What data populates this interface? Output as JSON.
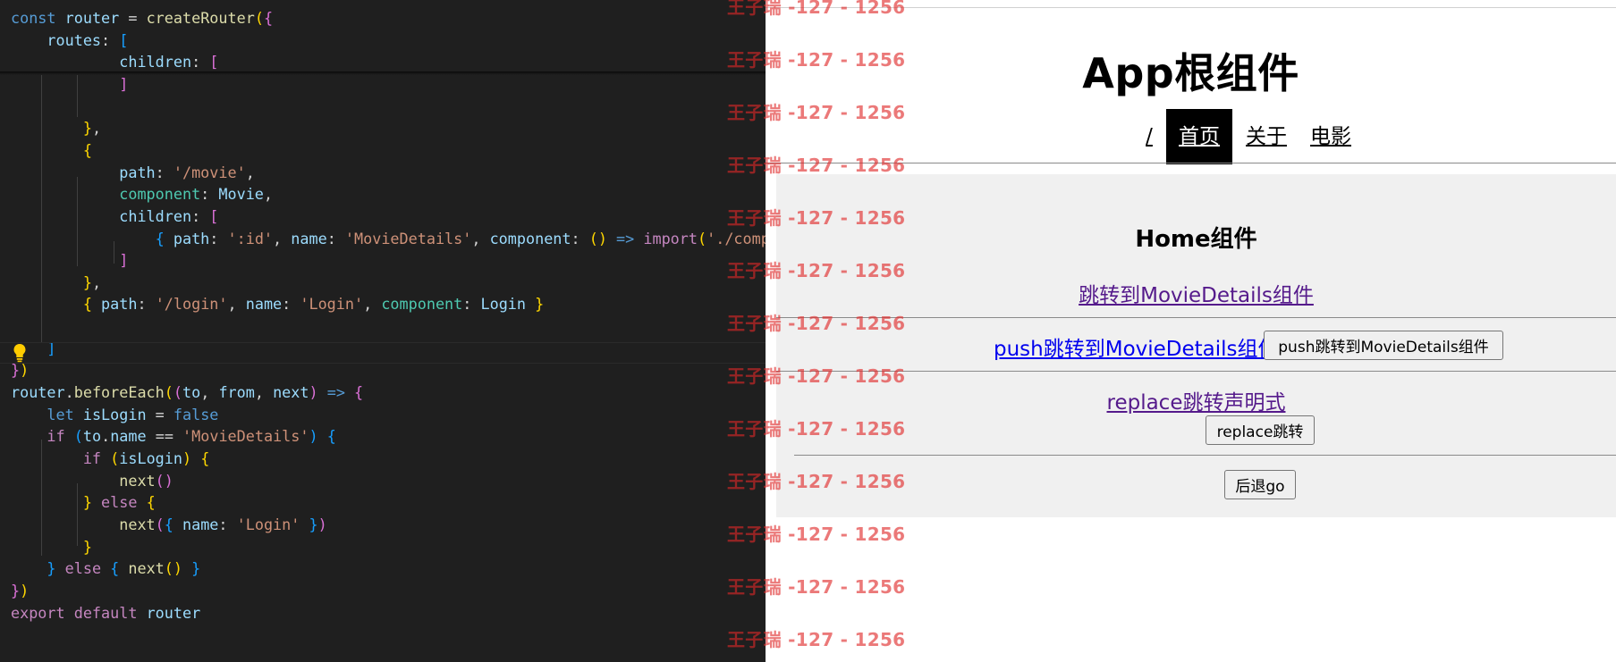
{
  "editor": {
    "lines": [
      [
        [
          "const",
          "kw"
        ],
        [
          " router ",
          "var"
        ],
        [
          "= ",
          "op"
        ],
        [
          "createRouter",
          "fn"
        ],
        [
          "(",
          "b1"
        ],
        [
          "{",
          "b2"
        ]
      ],
      [
        [
          "    routes",
          "var"
        ],
        [
          ": ",
          "op"
        ],
        [
          "[",
          "b3"
        ]
      ],
      [
        [
          "            children",
          "var"
        ],
        [
          ": ",
          "op"
        ],
        [
          "[",
          "b2"
        ]
      ],
      [
        [
          "            ",
          "op"
        ],
        [
          "]",
          "b2"
        ]
      ],
      [
        [
          "",
          ""
        ]
      ],
      [
        [
          "        ",
          "op"
        ],
        [
          "}",
          "b1"
        ],
        [
          ",",
          "op"
        ]
      ],
      [
        [
          "        ",
          "op"
        ],
        [
          "{",
          "b1"
        ]
      ],
      [
        [
          "            path",
          "var"
        ],
        [
          ": ",
          "op"
        ],
        [
          "'/movie'",
          "str"
        ],
        [
          ",",
          "op"
        ]
      ],
      [
        [
          "            component",
          "cls"
        ],
        [
          ": ",
          "op"
        ],
        [
          "Movie",
          "var"
        ],
        [
          ",",
          "op"
        ]
      ],
      [
        [
          "            children",
          "var"
        ],
        [
          ": ",
          "op"
        ],
        [
          "[",
          "b2"
        ]
      ],
      [
        [
          "                ",
          "op"
        ],
        [
          "{",
          "b3"
        ],
        [
          " path",
          "var"
        ],
        [
          ": ",
          "op"
        ],
        [
          "':id'",
          "str"
        ],
        [
          ", ",
          "op"
        ],
        [
          "name",
          "var"
        ],
        [
          ": ",
          "op"
        ],
        [
          "'MovieDetails'",
          "str"
        ],
        [
          ", ",
          "op"
        ],
        [
          "component",
          "var"
        ],
        [
          ": ",
          "op"
        ],
        [
          "()",
          "b1"
        ],
        [
          " => ",
          "kw"
        ],
        [
          "import",
          "ctl"
        ],
        [
          "(",
          "b1"
        ],
        [
          "'./comp",
          "str"
        ]
      ],
      [
        [
          "            ",
          "op"
        ],
        [
          "]",
          "b2"
        ]
      ],
      [
        [
          "        ",
          "op"
        ],
        [
          "}",
          "b1"
        ],
        [
          ",",
          "op"
        ]
      ],
      [
        [
          "        ",
          "op"
        ],
        [
          "{",
          "b1"
        ],
        [
          " path",
          "var"
        ],
        [
          ": ",
          "op"
        ],
        [
          "'/login'",
          "str"
        ],
        [
          ", ",
          "op"
        ],
        [
          "name",
          "var"
        ],
        [
          ": ",
          "op"
        ],
        [
          "'Login'",
          "str"
        ],
        [
          ", ",
          "op"
        ],
        [
          "component",
          "cls"
        ],
        [
          ": ",
          "op"
        ],
        [
          "Login",
          "var"
        ],
        [
          " }",
          "b1"
        ]
      ],
      [
        [
          "",
          ""
        ]
      ],
      [
        [
          "    ",
          "op"
        ],
        [
          "]",
          "b3"
        ]
      ],
      [
        [
          "}",
          "b2"
        ],
        [
          ")",
          "b1"
        ]
      ],
      [
        [
          "router",
          "var"
        ],
        [
          ".",
          "op"
        ],
        [
          "beforeEach",
          "fn"
        ],
        [
          "(",
          "b1"
        ],
        [
          "(",
          "b2"
        ],
        [
          "to",
          "var"
        ],
        [
          ", ",
          "op"
        ],
        [
          "from",
          "var"
        ],
        [
          ", ",
          "op"
        ],
        [
          "next",
          "var"
        ],
        [
          ")",
          "b2"
        ],
        [
          " => ",
          "kw"
        ],
        [
          "{",
          "b2"
        ]
      ],
      [
        [
          "    ",
          "op"
        ],
        [
          "let",
          "kw"
        ],
        [
          " isLogin ",
          "var"
        ],
        [
          "= ",
          "op"
        ],
        [
          "false",
          "kw"
        ]
      ],
      [
        [
          "    ",
          "op"
        ],
        [
          "if",
          "ctl"
        ],
        [
          " (",
          "b3"
        ],
        [
          "to",
          "var"
        ],
        [
          ".",
          "op"
        ],
        [
          "name",
          "var"
        ],
        [
          " == ",
          "op"
        ],
        [
          "'MovieDetails'",
          "str"
        ],
        [
          ")",
          "b3"
        ],
        [
          " {",
          "b3"
        ]
      ],
      [
        [
          "        ",
          "op"
        ],
        [
          "if",
          "ctl"
        ],
        [
          " (",
          "b1"
        ],
        [
          "isLogin",
          "var"
        ],
        [
          ")",
          "b1"
        ],
        [
          " {",
          "b1"
        ]
      ],
      [
        [
          "            ",
          "op"
        ],
        [
          "next",
          "fn"
        ],
        [
          "()",
          "b2"
        ]
      ],
      [
        [
          "        ",
          "op"
        ],
        [
          "}",
          "b1"
        ],
        [
          " else ",
          "ctl"
        ],
        [
          "{",
          "b1"
        ]
      ],
      [
        [
          "            ",
          "op"
        ],
        [
          "next",
          "fn"
        ],
        [
          "(",
          "b2"
        ],
        [
          "{",
          "b3"
        ],
        [
          " name",
          "var"
        ],
        [
          ": ",
          "op"
        ],
        [
          "'Login'",
          "str"
        ],
        [
          " }",
          "b3"
        ],
        [
          ")",
          "b2"
        ]
      ],
      [
        [
          "        ",
          "op"
        ],
        [
          "}",
          "b1"
        ]
      ],
      [
        [
          "    ",
          "op"
        ],
        [
          "}",
          "b3"
        ],
        [
          " else ",
          "ctl"
        ],
        [
          "{",
          "b3"
        ],
        [
          " next",
          "fn"
        ],
        [
          "()",
          "b1"
        ],
        [
          " }",
          "b3"
        ]
      ],
      [
        [
          "}",
          "b2"
        ],
        [
          ")",
          "b1"
        ]
      ],
      [
        [
          "export",
          "ctl"
        ],
        [
          " default ",
          "ctl"
        ],
        [
          "router",
          "var"
        ]
      ]
    ]
  },
  "preview": {
    "app_title": "App根组件",
    "nav": [
      {
        "label": "/",
        "active": false
      },
      {
        "label": "首页",
        "active": true
      },
      {
        "label": "关于",
        "active": false
      },
      {
        "label": "电影",
        "active": false
      }
    ],
    "home": {
      "title": "Home组件",
      "link_movie_details": "跳转到MovieDetails组件",
      "link_push": "push跳转到MovieDetails组件",
      "button_push": "push跳转到MovieDetails组件",
      "link_replace": "replace跳转声明式",
      "button_replace": "replace跳转",
      "button_back": "后退go"
    }
  },
  "watermark": {
    "text": "王子瑞 -127 - 1256",
    "count": 13
  },
  "colors": {
    "editor_bg": "#1f1f1f",
    "active_nav_bg": "#000000",
    "home_bg": "#f0f0f0",
    "visited_link": "#551a8b",
    "link": "#0000ee",
    "watermark": "#e02828"
  },
  "icons": {
    "lightbulb": "lightbulb-icon"
  }
}
